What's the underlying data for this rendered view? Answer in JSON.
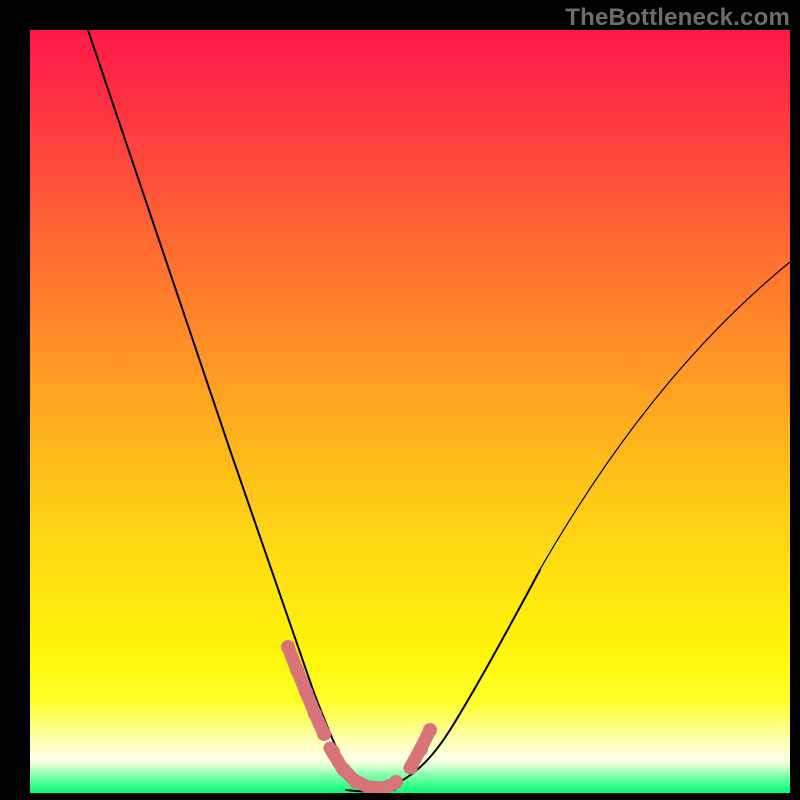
{
  "watermark": "TheBottleneck.com",
  "chart_data": {
    "type": "line",
    "title": "",
    "xlabel": "",
    "ylabel": "",
    "x_range": [
      0,
      100
    ],
    "y_range": [
      0,
      100
    ],
    "series": [
      {
        "name": "bottleneck-curve",
        "x": [
          8,
          12,
          16,
          20,
          24,
          28,
          31,
          34,
          36.5,
          38.5,
          40,
          41.5,
          43,
          45,
          47,
          49,
          52,
          56,
          61,
          67,
          74,
          82,
          90,
          100
        ],
        "y": [
          100,
          87,
          74,
          62,
          50,
          39,
          30,
          22,
          15,
          9,
          4,
          1.5,
          0.5,
          0.5,
          1.5,
          3,
          6,
          12,
          20,
          30,
          41,
          53,
          62,
          70
        ]
      }
    ],
    "markers": {
      "name": "highlight-points",
      "x": [
        34.5,
        35.8,
        37.2,
        38.8,
        40.2,
        41.5,
        43,
        44.5,
        46,
        47.5,
        49,
        50.2,
        51.2,
        52.2
      ],
      "y": [
        19,
        15,
        11,
        7.5,
        4,
        2,
        0.8,
        0.5,
        1,
        2,
        3.5,
        5.5,
        8,
        11
      ]
    },
    "colors": {
      "curve": "#000000",
      "markers": "#d9737a",
      "gradient_top": "#ff1a49",
      "gradient_bottom": "#00ff78"
    }
  }
}
